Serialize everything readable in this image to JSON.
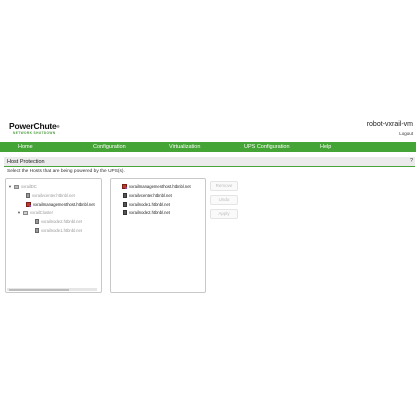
{
  "app": {
    "brand": "PowerChute",
    "trademark": "®",
    "brand_sub": "NETWORK SHUTDOWN",
    "hostname": "robot-vxrail-vm",
    "logout": "Logout"
  },
  "nav": {
    "items": [
      {
        "label": "Home"
      },
      {
        "label": "Configuration"
      },
      {
        "label": "Virtualization"
      },
      {
        "label": "UPS Configuration"
      },
      {
        "label": "Help"
      }
    ]
  },
  "section": {
    "title": "Host Protection",
    "help": "?",
    "instruction": "Select the Hosts that are being powered by the UPS(s)."
  },
  "left_tree": [
    {
      "label": "vxrailDC",
      "icon": "datacenter-icon",
      "toggle": "▼",
      "active": false
    },
    {
      "label": "vxrailvcenter.htbnbl.net",
      "icon": "host-icon",
      "active": false
    },
    {
      "label": "vxrailmanagementhost.htbnbl.net",
      "icon": "vm-icon",
      "active": true
    },
    {
      "label": "vxrailCluster",
      "icon": "cluster-icon",
      "toggle": "▼",
      "active": false
    },
    {
      "label": "vxrailnode2.htbnbl.net",
      "icon": "host-icon",
      "active": false
    },
    {
      "label": "vxrailnode1.htbnbl.net",
      "icon": "host-icon",
      "active": false
    }
  ],
  "right_list": [
    {
      "label": "vxrailmanagementhost.htbnbl.net",
      "icon": "vm-icon"
    },
    {
      "label": "vxrailvcenter.htbnbl.net",
      "icon": "host-icon"
    },
    {
      "label": "vxrailnode1.htbnbl.net",
      "icon": "host-icon"
    },
    {
      "label": "vxrailnode2.htbnbl.net",
      "icon": "host-icon"
    }
  ],
  "buttons": {
    "remove": "Remove",
    "undo": "Undo",
    "apply": "Apply"
  },
  "colors": {
    "nav_green": "#45a436",
    "section_bg": "#ebebeb"
  }
}
